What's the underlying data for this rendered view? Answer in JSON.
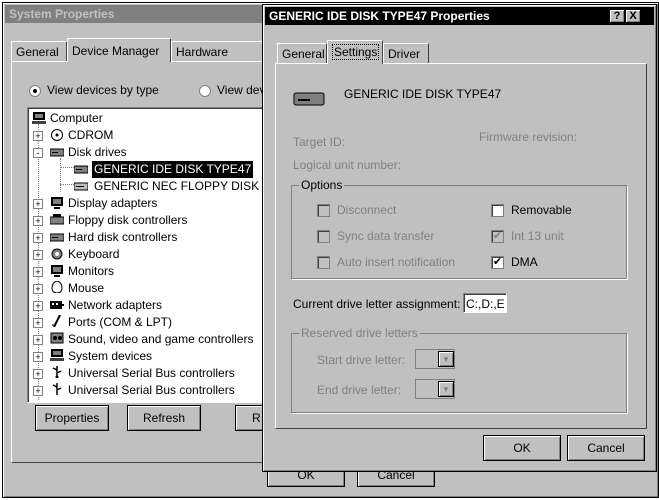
{
  "sysprops": {
    "title": "System Properties",
    "tabs": [
      "General",
      "Device Manager",
      "Hardware Profiles"
    ],
    "radio_by_type": "View devices by type",
    "radio_by_conn": "View dev",
    "tree": [
      {
        "label": "Computer",
        "icon": "computer-icon",
        "level": 0
      },
      {
        "label": "CDROM",
        "icon": "cdrom-icon",
        "level": 1,
        "exp": "+"
      },
      {
        "label": "Disk drives",
        "icon": "disk-drive-icon",
        "level": 1,
        "exp": "-"
      },
      {
        "label": "GENERIC IDE  DISK TYPE47",
        "icon": "disk-drive-icon",
        "level": 2,
        "selected": true
      },
      {
        "label": "GENERIC NEC  FLOPPY DISK",
        "icon": "floppy-icon",
        "level": 2
      },
      {
        "label": "Display adapters",
        "icon": "display-icon",
        "level": 1,
        "exp": "+"
      },
      {
        "label": "Floppy disk controllers",
        "icon": "floppy-controller-icon",
        "level": 1,
        "exp": "+"
      },
      {
        "label": "Hard disk controllers",
        "icon": "hdd-controller-icon",
        "level": 1,
        "exp": "+"
      },
      {
        "label": "Keyboard",
        "icon": "keyboard-icon",
        "level": 1,
        "exp": "+"
      },
      {
        "label": "Monitors",
        "icon": "monitor-icon",
        "level": 1,
        "exp": "+"
      },
      {
        "label": "Mouse",
        "icon": "mouse-icon",
        "level": 1,
        "exp": "+"
      },
      {
        "label": "Network adapters",
        "icon": "network-icon",
        "level": 1,
        "exp": "+"
      },
      {
        "label": "Ports (COM & LPT)",
        "icon": "port-icon",
        "level": 1,
        "exp": "+"
      },
      {
        "label": "Sound, video and game controllers",
        "icon": "sound-icon",
        "level": 1,
        "exp": "+"
      },
      {
        "label": "System devices",
        "icon": "system-icon",
        "level": 1,
        "exp": "+"
      },
      {
        "label": "Universal Serial Bus controllers",
        "icon": "usb-icon",
        "level": 1,
        "exp": "+"
      },
      {
        "label": "Universal Serial Bus controllers",
        "icon": "usb-icon",
        "level": 1,
        "exp": "+"
      }
    ],
    "btn_properties": "Properties",
    "btn_refresh": "Refresh",
    "btn_remove": "R",
    "btn_ok": "OK",
    "btn_cancel": "Cancel"
  },
  "diskprops": {
    "title": "GENERIC IDE  DISK TYPE47 Properties",
    "help_btn": "?",
    "close_btn": "X",
    "tabs": [
      "General",
      "Settings",
      "Driver"
    ],
    "device_name": "GENERIC IDE  DISK TYPE47",
    "target_id": "Target ID:",
    "firmware": "Firmware revision:",
    "lun": "Logical unit number:",
    "options_title": "Options",
    "opt_disconnect": "Disconnect",
    "opt_removable": "Removable",
    "opt_sync": "Sync data transfer",
    "opt_int13": "Int 13 unit",
    "opt_autoinsert": "Auto insert notification",
    "opt_dma": "DMA",
    "check_mark": "✔",
    "current_drive_label": "Current drive letter assignment:",
    "current_drive_value": "C:,D:,E",
    "reserved_title": "Reserved drive letters",
    "start_drive": "Start drive letter:",
    "end_drive": "End drive letter:",
    "dropdown_arrow": "▼",
    "btn_ok": "OK",
    "btn_cancel": "Cancel"
  }
}
